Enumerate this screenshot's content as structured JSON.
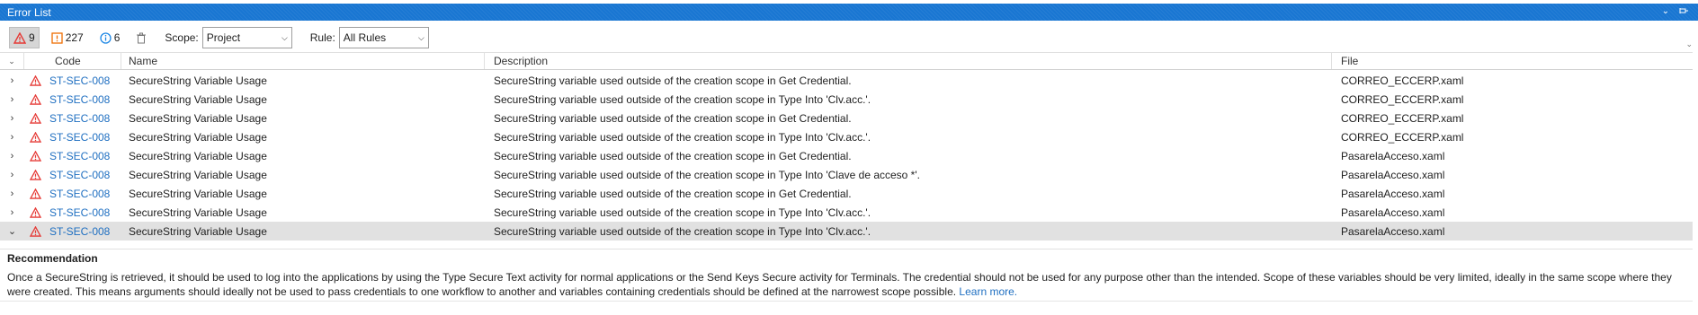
{
  "panel": {
    "title": "Error List"
  },
  "titlebar_icons": [
    "chevron-down-icon",
    "pin-icon"
  ],
  "toolbar": {
    "errors_count": "9",
    "warnings_count": "227",
    "info_count": "6",
    "scope_label": "Scope:",
    "scope_value": "Project",
    "rule_label": "Rule:",
    "rule_value": "All Rules"
  },
  "columns": {
    "code": "Code",
    "name": "Name",
    "description": "Description",
    "file": "File"
  },
  "rows": [
    {
      "code": "ST-SEC-008",
      "name": "SecureString Variable Usage",
      "description": "SecureString variable used outside of the creation scope in Get Credential.",
      "file": "CORREO_ECCERP.xaml"
    },
    {
      "code": "ST-SEC-008",
      "name": "SecureString Variable Usage",
      "description": "SecureString variable used outside of the creation scope in Type Into 'Clv.acc.'.",
      "file": "CORREO_ECCERP.xaml"
    },
    {
      "code": "ST-SEC-008",
      "name": "SecureString Variable Usage",
      "description": "SecureString variable used outside of the creation scope in Get Credential.",
      "file": "CORREO_ECCERP.xaml"
    },
    {
      "code": "ST-SEC-008",
      "name": "SecureString Variable Usage",
      "description": "SecureString variable used outside of the creation scope in Type Into 'Clv.acc.'.",
      "file": "CORREO_ECCERP.xaml"
    },
    {
      "code": "ST-SEC-008",
      "name": "SecureString Variable Usage",
      "description": "SecureString variable used outside of the creation scope in Get Credential.",
      "file": "PasarelaAcceso.xaml"
    },
    {
      "code": "ST-SEC-008",
      "name": "SecureString Variable Usage",
      "description": "SecureString variable used outside of the creation scope in Type Into 'Clave de acceso *'.",
      "file": "PasarelaAcceso.xaml"
    },
    {
      "code": "ST-SEC-008",
      "name": "SecureString Variable Usage",
      "description": "SecureString variable used outside of the creation scope in Get Credential.",
      "file": "PasarelaAcceso.xaml"
    },
    {
      "code": "ST-SEC-008",
      "name": "SecureString Variable Usage",
      "description": "SecureString variable used outside of the creation scope in Type Into 'Clv.acc.'.",
      "file": "PasarelaAcceso.xaml"
    },
    {
      "code": "ST-SEC-008",
      "name": "SecureString Variable Usage",
      "description": "SecureString variable used outside of the creation scope in Type Into 'Clv.acc.'.",
      "file": "PasarelaAcceso.xaml",
      "selected": true
    }
  ],
  "recommendation": {
    "heading": "Recommendation",
    "text": "Once a SecureString is retrieved, it should be used to log into the applications by using the Type Secure Text activity for normal applications or the Send Keys Secure activity for Terminals. The credential should not be used for any purpose other than the intended. Scope of these variables should be very limited, ideally in the same scope where they were created. This means arguments should ideally not be used to pass credentials to one workflow to another and variables containing credentials should be defined at the narrowest scope possible.",
    "link": "Learn more."
  },
  "colors": {
    "accent": "#1976d2",
    "error": "#e53935",
    "warning": "#ef6c00",
    "info": "#1e88e5",
    "link": "#1f6fc1",
    "selected_row": "#e1e1e1"
  }
}
